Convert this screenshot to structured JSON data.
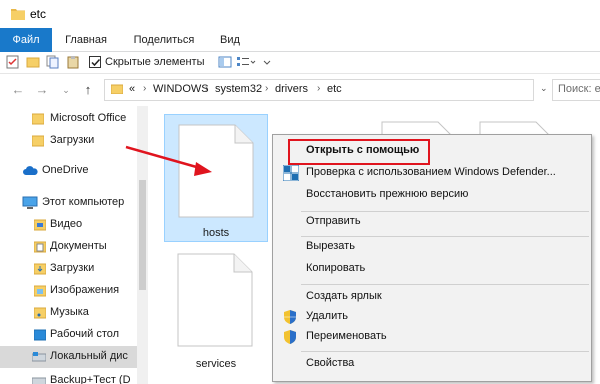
{
  "window": {
    "title": "etc"
  },
  "ribbon": {
    "tabs": [
      {
        "label": "Файл"
      },
      {
        "label": "Главная"
      },
      {
        "label": "Поделиться"
      },
      {
        "label": "Вид"
      }
    ]
  },
  "toolbar": {
    "hidden_items_label": "Скрытые элементы",
    "hidden_items_checked": true
  },
  "address": {
    "prefix": "«",
    "crumbs": [
      "WINDOWS",
      "system32",
      "drivers",
      "etc"
    ],
    "search_placeholder": "Поиск: etc"
  },
  "nav": {
    "items": [
      {
        "label": "Microsoft Office",
        "icon": "folder-icon"
      },
      {
        "label": "Загрузки",
        "icon": "folder-icon"
      },
      {
        "label": "OneDrive",
        "icon": "onedrive-icon"
      },
      {
        "label": "Этот компьютер",
        "icon": "computer-icon"
      },
      {
        "label": "Видео",
        "icon": "video-folder-icon"
      },
      {
        "label": "Документы",
        "icon": "documents-folder-icon"
      },
      {
        "label": "Загрузки",
        "icon": "downloads-folder-icon"
      },
      {
        "label": "Изображения",
        "icon": "pictures-folder-icon"
      },
      {
        "label": "Музыка",
        "icon": "music-folder-icon"
      },
      {
        "label": "Рабочий стол",
        "icon": "desktop-folder-icon"
      },
      {
        "label": "Локальный дис",
        "icon": "drive-icon"
      },
      {
        "label": "Backup+Тест (D",
        "icon": "drive-icon"
      }
    ]
  },
  "files": [
    {
      "name": "hosts",
      "selected": true
    },
    {
      "name": "services",
      "selected": false
    }
  ],
  "context_menu": {
    "items": [
      {
        "label": "Открыть с помощью",
        "bold": true
      },
      {
        "label": "Проверка с использованием Windows Defender...",
        "icon": "defender-icon"
      },
      {
        "label": "Восстановить прежнюю версию"
      },
      {
        "label": "Отправить"
      },
      {
        "label": "Вырезать"
      },
      {
        "label": "Копировать"
      },
      {
        "label": "Создать ярлык"
      },
      {
        "label": "Удалить",
        "icon": "shield-icon"
      },
      {
        "label": "Переименовать",
        "icon": "shield-icon"
      },
      {
        "label": "Свойства"
      }
    ]
  },
  "colors": {
    "file_tab_bg": "#1979ca",
    "selection_bg": "#cce8ff",
    "highlight_red": "#e0141e",
    "menu_bg": "#f2f2f2"
  }
}
